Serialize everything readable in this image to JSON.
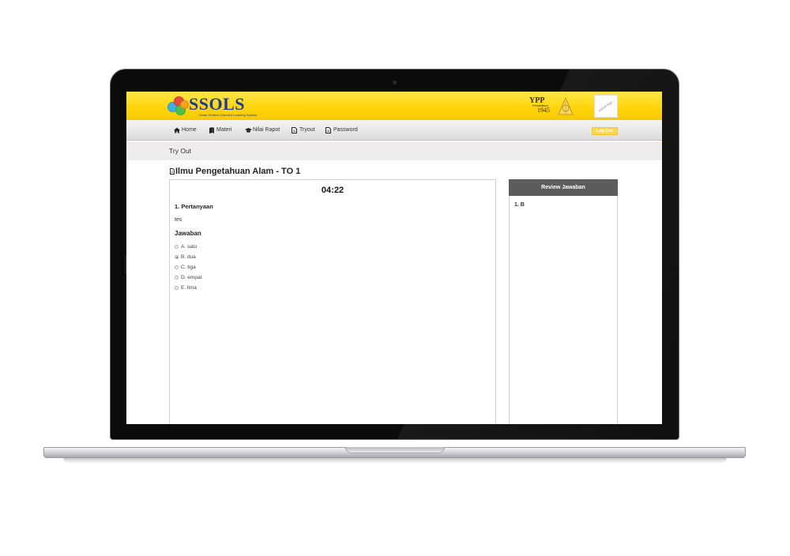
{
  "app": {
    "logo_text": "SSOLS",
    "logo_tagline": "Smart Student Oriented Learning System",
    "partner_logo": "YPP",
    "partner_sub": "Pendidikan",
    "partner_year": "1945",
    "school_logo_text": "school logo",
    "colors": {
      "header": "#ffd60a",
      "logo_text": "#1e3aa0",
      "panel_head": "#5c5c5c"
    }
  },
  "nav": {
    "items": [
      {
        "label": "Home",
        "icon": "home-icon"
      },
      {
        "label": "Materi",
        "icon": "book-icon"
      },
      {
        "label": "Nilai Rapot",
        "icon": "graduation-cap-icon"
      },
      {
        "label": "Tryout",
        "icon": "document-icon"
      },
      {
        "label": "Password",
        "icon": "document-icon"
      }
    ],
    "logout_label": "Log Out"
  },
  "subbar": {
    "title": "Try Out"
  },
  "page": {
    "title": "Ilmu Pengetahuan Alam - TO 1"
  },
  "question": {
    "timer": "04:22",
    "heading": "1. Pertanyaan",
    "text": "tes",
    "answer_heading": "Jawaban",
    "options": [
      {
        "label": "A. satu",
        "selected": false
      },
      {
        "label": "B. dua",
        "selected": true
      },
      {
        "label": "C. tiga",
        "selected": false
      },
      {
        "label": "D. empat",
        "selected": false
      },
      {
        "label": "E. lima",
        "selected": false
      }
    ]
  },
  "review": {
    "title": "Review Jawaban",
    "items": [
      "1. B"
    ]
  }
}
